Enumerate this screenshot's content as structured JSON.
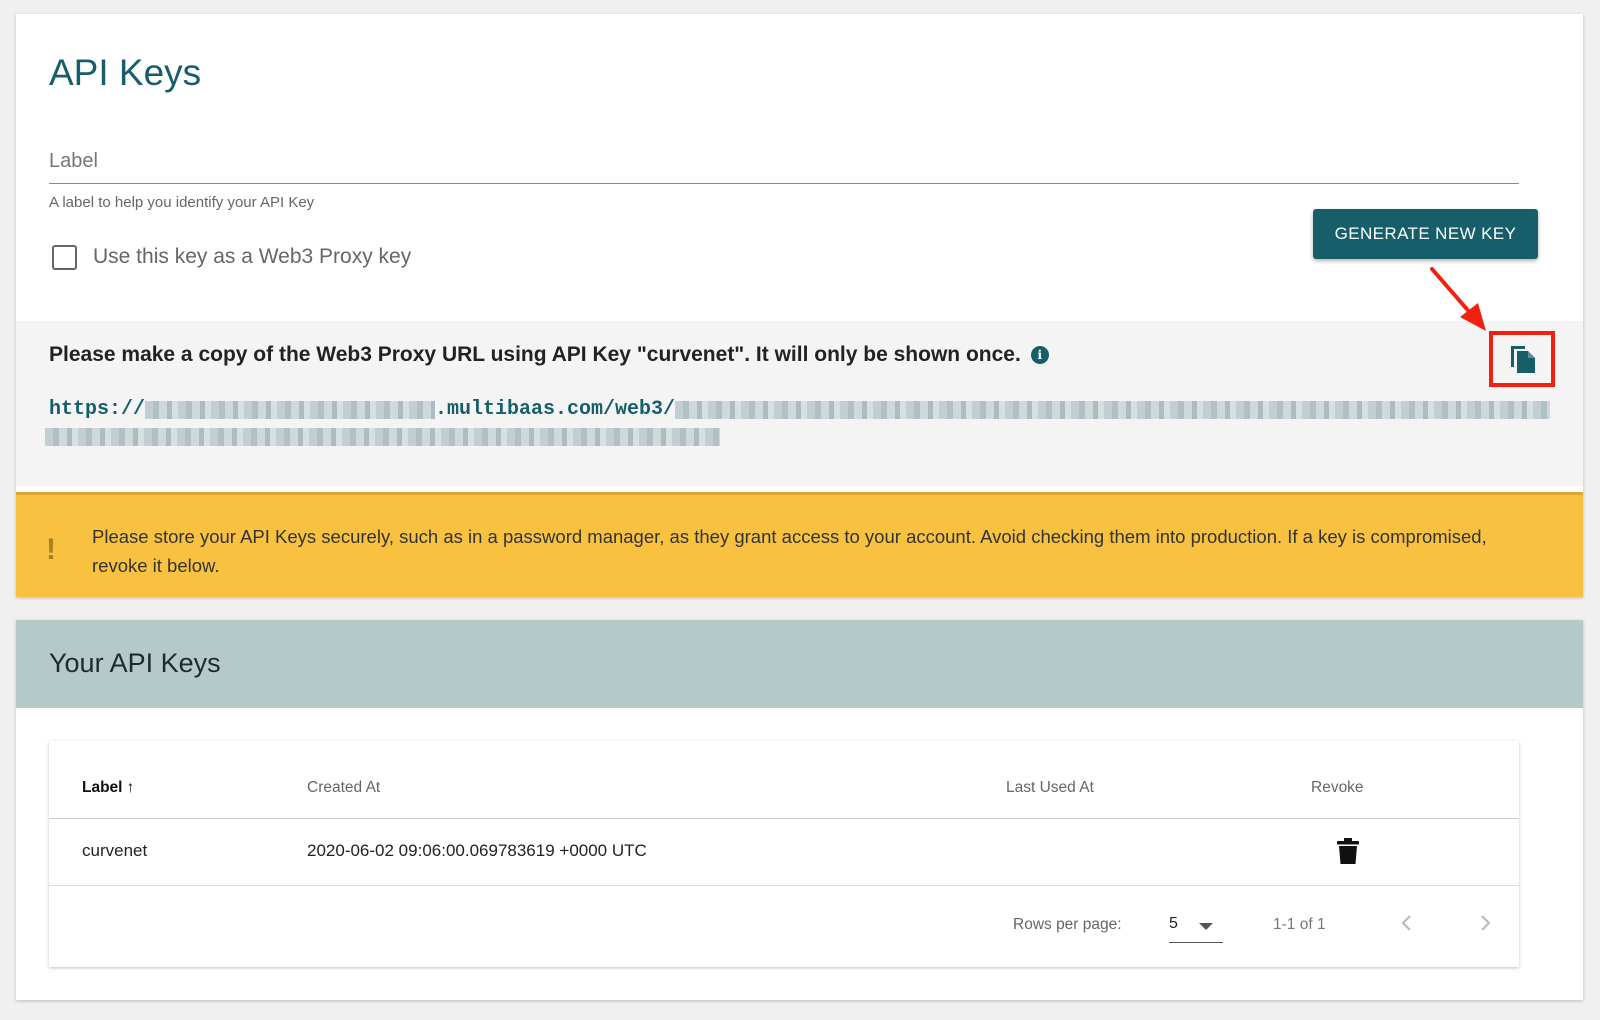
{
  "header": {
    "title": "API Keys"
  },
  "form": {
    "label_placeholder": "Label",
    "label_value": "",
    "helper_text": "A label to help you identify your API Key",
    "web3_proxy_checkbox_label": "Use this key as a Web3 Proxy key",
    "web3_proxy_checked": false,
    "generate_button_label": "GENERATE NEW KEY"
  },
  "proxy_url": {
    "notice": "Please make a copy of the Web3 Proxy URL using API Key \"curvenet\". It will only be shown once.",
    "info_icon": "info-icon",
    "url_prefix": "https://",
    "url_middle": ".multibaas.com/web3/",
    "copy_icon": "copy-icon"
  },
  "warning": {
    "icon": "!",
    "text": "Please store your API Keys securely, such as in a password manager, as they grant access to your account. Avoid checking them into production. If a key is compromised, revoke it below."
  },
  "keys_section": {
    "title": "Your API Keys",
    "columns": [
      "Label",
      "Created At",
      "Last Used At",
      "Revoke"
    ],
    "sort_indicator": "↑",
    "rows": [
      {
        "label": "curvenet",
        "created_at": "2020-06-02 09:06:00.069783619 +0000 UTC",
        "last_used_at": "",
        "revoke_icon": "trash-icon"
      }
    ],
    "pagination": {
      "rows_per_page_label": "Rows per page:",
      "rows_per_page_value": "5",
      "range_label": "1-1 of 1"
    }
  },
  "colors": {
    "brand": "#155e6a",
    "warning": "#f8c240",
    "highlight": "#f2200f",
    "section_header": "#b4cac8"
  }
}
